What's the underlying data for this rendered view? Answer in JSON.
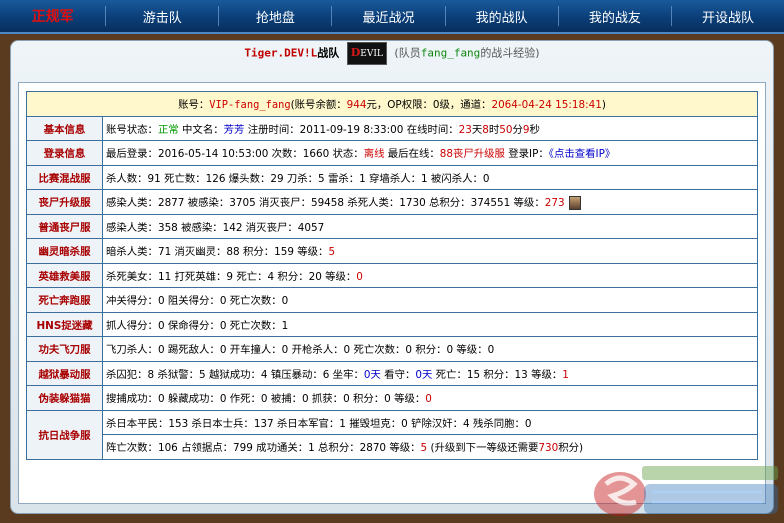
{
  "nav": {
    "brand": "正规军",
    "items": [
      "游击队",
      "抢地盘",
      "最近战况",
      "我的战队",
      "我的战友",
      "开设战队"
    ]
  },
  "team": {
    "name": "Tiger.DEV!L",
    "name_suffix": "战队",
    "logo_text": "EVIL",
    "logo_prefix": "D",
    "note_prefix": "(队员",
    "member": "fang_fang",
    "note_suffix": "的战斗经验)"
  },
  "account": {
    "label_prefix": "账号：",
    "account_id": "VIP-fang_fang",
    "balance_label": "(账号余额：",
    "balance": "944",
    "op_label": "元，OP权限：",
    "op_level": "0级",
    "channel_label": "，通道：",
    "channel_date": "2064-04-24 15:18:41",
    "suffix": ")"
  },
  "rows": [
    {
      "label": "基本信息",
      "segments": [
        {
          "t": "账号状态："
        },
        {
          "t": "正常",
          "c": "green"
        },
        {
          "t": " 中文名："
        },
        {
          "t": "芳芳",
          "c": "blue"
        },
        {
          "t": " 注册时间：2011-09-19 8:33:00 在线时间："
        },
        {
          "t": "23",
          "c": "red"
        },
        {
          "t": "天"
        },
        {
          "t": "8",
          "c": "red"
        },
        {
          "t": "时"
        },
        {
          "t": "50",
          "c": "red"
        },
        {
          "t": "分"
        },
        {
          "t": "9",
          "c": "red"
        },
        {
          "t": "秒"
        }
      ]
    },
    {
      "label": "登录信息",
      "segments": [
        {
          "t": "最后登录：2016-05-14 10:53:00 次数：1660 状态："
        },
        {
          "t": "离线",
          "c": "red"
        },
        {
          "t": " 最后在线："
        },
        {
          "t": "88丧尸升级服",
          "c": "red"
        },
        {
          "t": " 登录IP：",
          "c": ""
        },
        {
          "t": "《点击查看IP》",
          "c": "blue"
        }
      ]
    },
    {
      "label": "比赛混战服",
      "segments": [
        {
          "t": "杀人数：91 死亡数：126 爆头数：29 刀杀：5 雷杀：1 穿墙杀人：1 被闪杀人：0"
        }
      ]
    },
    {
      "label": "丧尸升级服",
      "segments": [
        {
          "t": "感染人类：2877 被感染：3705 消灭丧尸：59458 杀死人类：1730 总积分：374551 等级："
        },
        {
          "t": "273",
          "c": "red"
        }
      ],
      "avatar": true
    },
    {
      "label": "普通丧尸服",
      "segments": [
        {
          "t": "感染人类：358 被感染：142 消灭丧尸：4057"
        }
      ]
    },
    {
      "label": "幽灵暗杀服",
      "segments": [
        {
          "t": "暗杀人类：71 消灭幽灵：88 积分：159 等级："
        },
        {
          "t": "5",
          "c": "red"
        }
      ]
    },
    {
      "label": "英雄救美服",
      "segments": [
        {
          "t": "杀死美女：11 打死英雄：9 死亡：4 积分：20 等级："
        },
        {
          "t": "0",
          "c": "red"
        }
      ]
    },
    {
      "label": "死亡奔跑服",
      "segments": [
        {
          "t": "冲关得分：0 阻关得分：0 死亡次数：0"
        }
      ]
    },
    {
      "label": "HNS捉迷藏",
      "segments": [
        {
          "t": "抓人得分：0 保命得分：0 死亡次数：1"
        }
      ]
    },
    {
      "label": "功夫飞刀服",
      "segments": [
        {
          "t": "飞刀杀人：0 踢死敌人：0 开车撞人：0 开枪杀人：0 死亡次数：0 积分：0 等级：0"
        }
      ]
    },
    {
      "label": "越狱暴动服",
      "segments": [
        {
          "t": "杀囚犯：8 杀狱警：5 越狱成功：4 镇压暴动：6 坐牢："
        },
        {
          "t": "0天",
          "c": "blue"
        },
        {
          "t": " 看守："
        },
        {
          "t": "0天",
          "c": "blue"
        },
        {
          "t": " 死亡：15 积分：13 等级："
        },
        {
          "t": "1",
          "c": "red"
        }
      ]
    },
    {
      "label": "伪装躲猫猫",
      "segments": [
        {
          "t": "搜捕成功：0 躲藏成功：0 作死：0 被捕：0 抓获：0 积分：0 等级："
        },
        {
          "t": "0",
          "c": "red"
        }
      ]
    }
  ],
  "antiwar": {
    "label": "抗日战争服",
    "line1": [
      {
        "t": "杀日本平民：153 杀日本士兵：137 杀日本军官：1 摧毁坦克：0 铲除汉奸：4 残杀同胞：0"
      }
    ],
    "line2": [
      {
        "t": "阵亡次数：106 占领据点：799 成功通关：1 总积分：2870 等级："
      },
      {
        "t": "5",
        "c": "red"
      },
      {
        "t": " (升级到下一等级还需要"
      },
      {
        "t": "730",
        "c": "red"
      },
      {
        "t": "积分)"
      }
    ]
  }
}
